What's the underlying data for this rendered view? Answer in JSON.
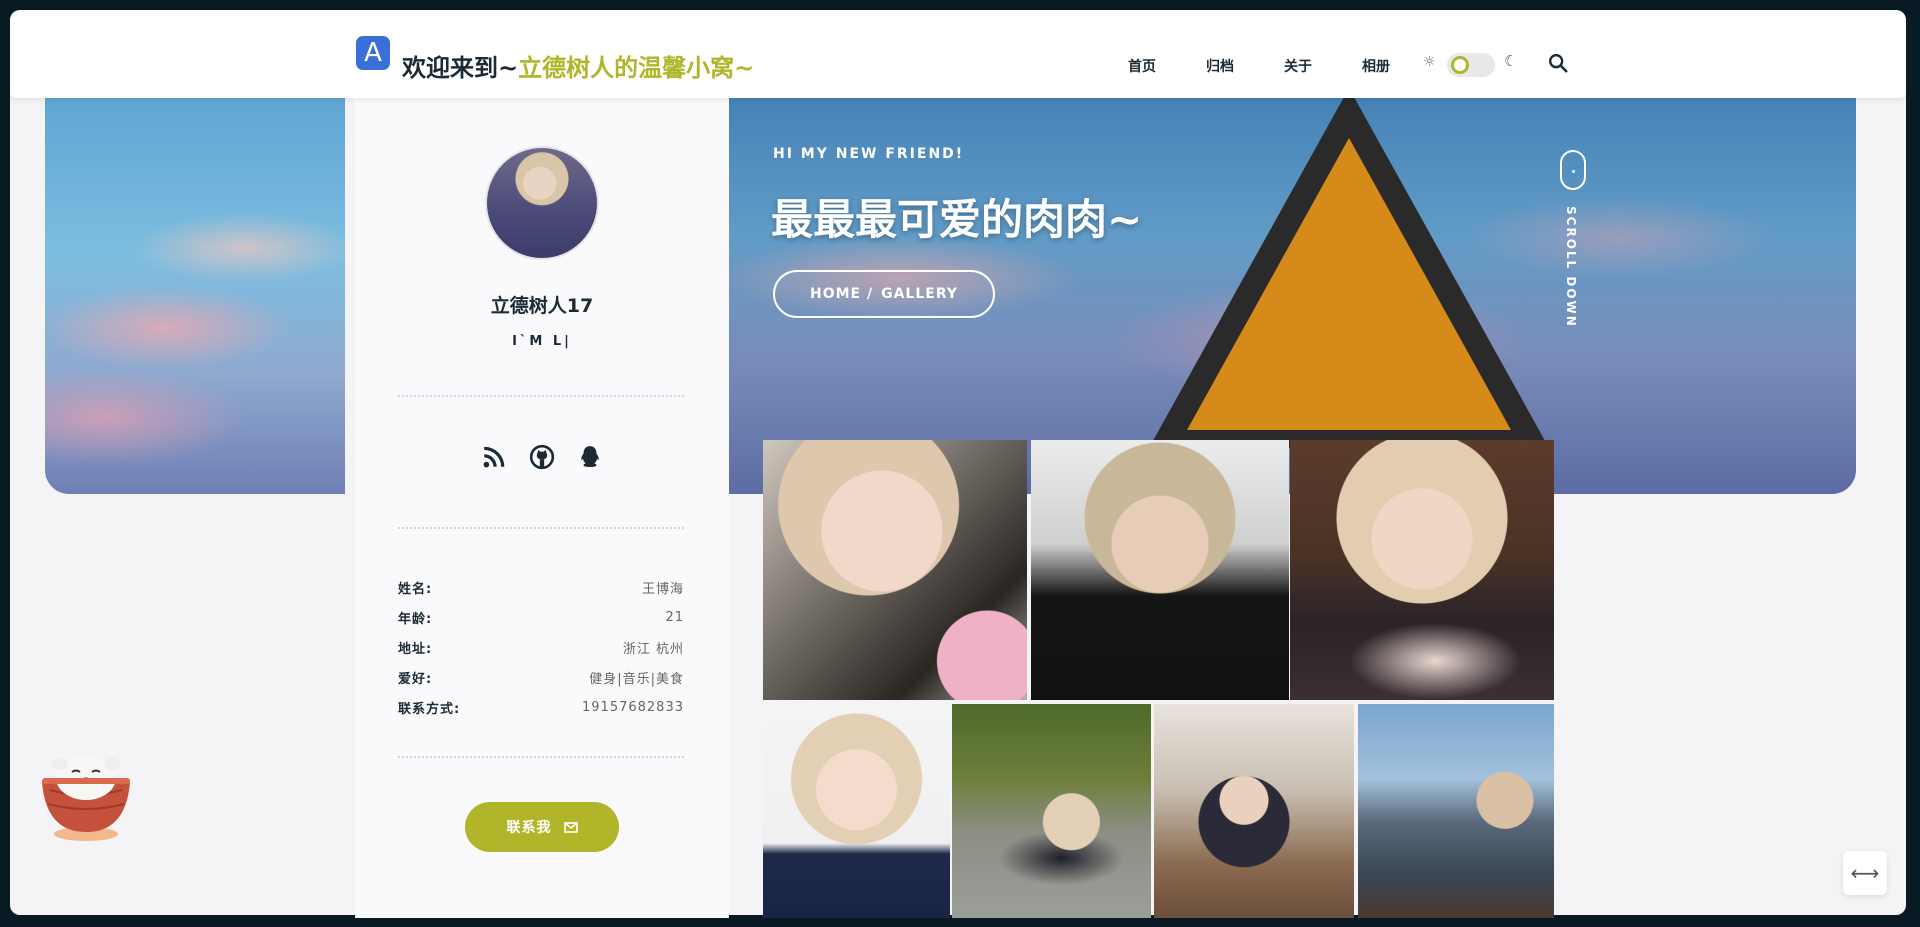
{
  "header": {
    "logo_glyph": "A",
    "title_prefix": "欢迎来到~",
    "title_accent": "立德树人的温馨小窝~",
    "accent_color": "#b1b52a",
    "nav": [
      "首页",
      "归档",
      "关于",
      "相册"
    ],
    "theme_icons": [
      "sun-icon",
      "moon-icon"
    ],
    "search_icon": "search-icon"
  },
  "banner": {
    "subtitle": "HI MY NEW FRIEND!",
    "title": "最最最可爱的肉肉~",
    "breadcrumb_home": "HOME /",
    "breadcrumb_current": "GALLERY",
    "scroll_text": "SCROLL DOWN"
  },
  "profile": {
    "name": "立德树人17",
    "motto": "I`M L|",
    "social_icons": [
      "rss-icon",
      "github-icon",
      "qq-icon"
    ],
    "info": [
      {
        "key": "姓名:",
        "value": "王博海"
      },
      {
        "key": "年龄:",
        "value": "21"
      },
      {
        "key": "地址:",
        "value": "浙江 杭州"
      },
      {
        "key": "爱好:",
        "value": "健身|音乐|美食"
      },
      {
        "key": "联系方式:",
        "value": "19157682833"
      }
    ],
    "contact_button": "联系我",
    "contact_icon": "mail-icon"
  },
  "gallery": {
    "photos": [
      "photo-1",
      "photo-2",
      "photo-3",
      "photo-4",
      "photo-5",
      "photo-6",
      "photo-7"
    ]
  },
  "float_button_glyph": "⟷"
}
